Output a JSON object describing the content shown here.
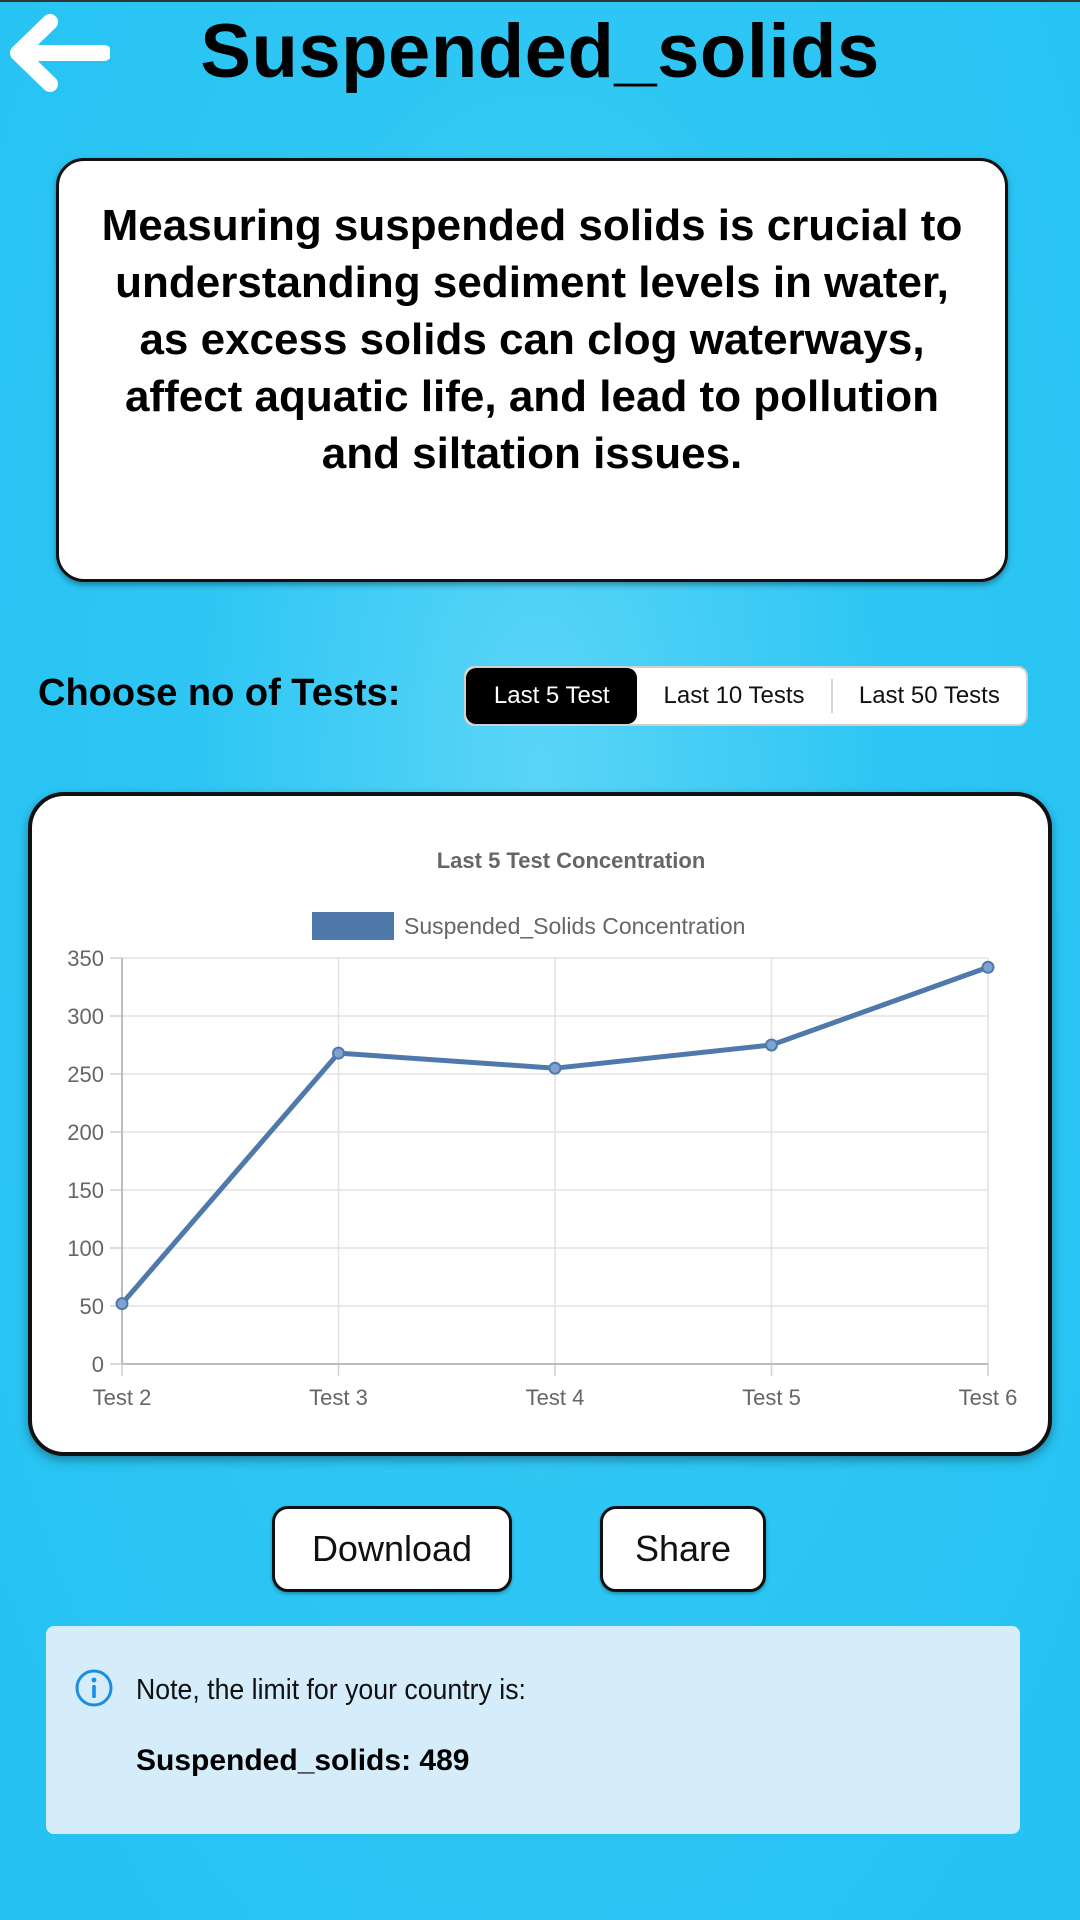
{
  "header": {
    "title": "Suspended_solids",
    "back_icon": "arrow-left-icon"
  },
  "description": "Measuring suspended solids is crucial to understanding sediment levels in water, as excess solids can clog waterways, affect aquatic life, and lead to pollution and siltation issues.",
  "test_selector": {
    "label": "Choose no of Tests:",
    "options": [
      "Last 5 Test",
      "Last 10 Tests",
      "Last 50 Tests"
    ],
    "selected": "Last 5 Test"
  },
  "chart_data": {
    "type": "line",
    "title": "Last 5 Test Concentration",
    "legend": "Suspended_Solids Concentration",
    "categories": [
      "Test 2",
      "Test 3",
      "Test 4",
      "Test 5",
      "Test 6"
    ],
    "values": [
      52,
      268,
      255,
      275,
      342
    ],
    "ylim": [
      0,
      350
    ],
    "yticks": [
      0,
      50,
      100,
      150,
      200,
      250,
      300,
      350
    ],
    "grid": true,
    "color": "#4e79aa"
  },
  "actions": {
    "download_label": "Download",
    "share_label": "Share"
  },
  "note": {
    "icon": "info-icon",
    "text": "Note, the limit for your country is:",
    "value": "Suspended_solids: 489"
  },
  "colors": {
    "background": "#2ec6f4",
    "accent": "#000000",
    "note_bg": "#d5ecfa"
  }
}
